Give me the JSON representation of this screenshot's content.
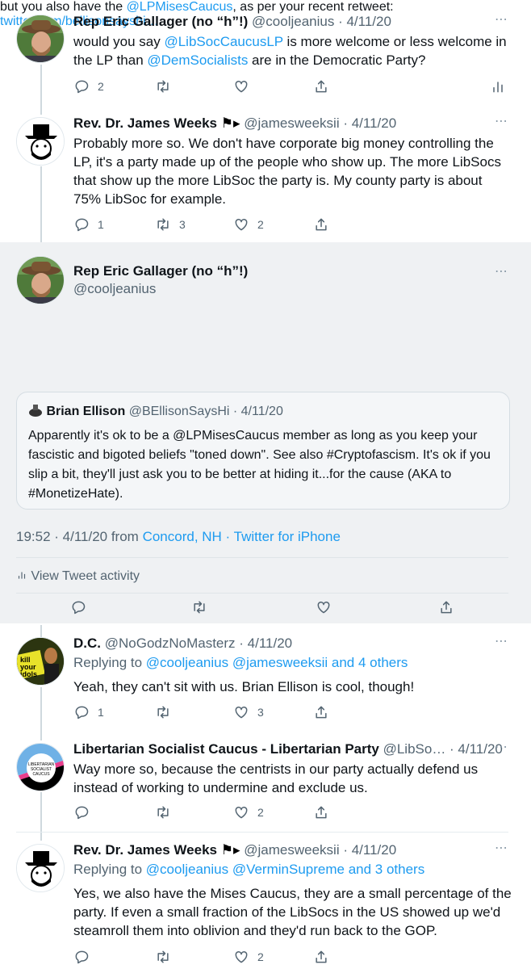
{
  "colors": {
    "link": "#1d9bf0",
    "muted": "#536471",
    "focus_bg": "#eff1f3"
  },
  "tweets": [
    {
      "name": "Rep Eric Gallager (no “h”!)",
      "meta": "@cooljeanius · 4/11/20",
      "text_pre": "would you say ",
      "mention1": "@LibSocCaucusLP",
      "text_mid": " is more welcome or less welcome in the LP than ",
      "mention2": "@DemSocialists",
      "text_post": " are in the Democratic Party?",
      "reply_count": "2",
      "retweet_count": "",
      "like_count": ""
    },
    {
      "name": "Rev. Dr. James Weeks",
      "flags": "⚑▸",
      "meta": "@jamesweeksii · 4/11/20",
      "text": "Probably more so. We don't have corporate big money controlling the LP, it's a party made up of the people who show up. The more LibSocs that show up the more LibSoc the party is. My county party is about 75% LibSoc for example.",
      "reply_count": "1",
      "retweet_count": "3",
      "like_count": "2"
    }
  ],
  "focus": {
    "name": "Rep Eric Gallager (no “h”!)",
    "handle": "@cooljeanius",
    "text_pre": "but you also have the ",
    "mention": "@LPMisesCaucus",
    "text_mid": ", as per your recent retweet: ",
    "url": "twitter.com/bellisonsayshi…",
    "quote": {
      "name": "Brian Ellison",
      "meta": "@BEllisonSaysHi · 4/11/20",
      "text": "Apparently it's ok to be a @LPMisesCaucus member as long as you keep your fascistic and bigoted beliefs \"toned down\". See also #Cryptofascism. It's ok if you slip a bit, they'll just ask you to be better at hiding it...for the cause (AKA to #MonetizeHate)."
    },
    "time": "19:52 · 4/11/20 from ",
    "location": "Concord, NH",
    "client": " · Twitter for iPhone",
    "activity": "View Tweet activity"
  },
  "replies": [
    {
      "name": "D.C.",
      "meta": "@NoGodzNoMasterz · 4/11/20",
      "replying_label": "Replying to ",
      "replying_users": "@cooljeanius @jamesweeksii and 4 others",
      "text": "Yeah, they can't sit with us. Brian Ellison is cool, though!",
      "avatar_text": "kill your idols",
      "reply_count": "1",
      "retweet_count": "",
      "like_count": "3"
    },
    {
      "name": "Libertarian Socialist Caucus - Libertarian Party",
      "meta": "@LibSo… · 4/11/20",
      "text": "Way more so, because the centrists in our party actually defend us instead of working to undermine and exclude us.",
      "avatar_text": "LIBERTARIAN SOCIALIST CAUCUS",
      "reply_count": "",
      "retweet_count": "",
      "like_count": "2"
    },
    {
      "name": "Rev. Dr. James Weeks",
      "flags": "⚑▸",
      "meta": "@jamesweeksii · 4/11/20",
      "replying_label": "Replying to ",
      "replying_users": "@cooljeanius @VerminSupreme and 3 others",
      "text": "Yes, we also have the Mises Caucus, they are a small percentage of the party. If even a small fraction of the LibSocs in the US showed up we'd steamroll them into oblivion and they'd run back to the GOP.",
      "reply_count": "",
      "retweet_count": "",
      "like_count": "2"
    }
  ],
  "icons": [
    "reply-icon",
    "retweet-icon",
    "like-icon",
    "share-icon",
    "analytics-icon",
    "more-icon"
  ]
}
